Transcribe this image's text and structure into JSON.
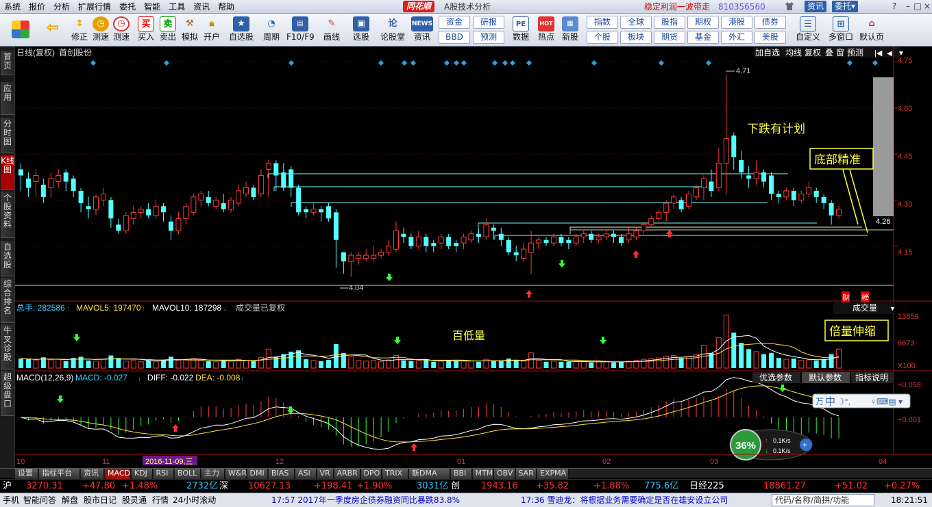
{
  "menu": {
    "items": [
      "系统",
      "报价",
      "分析",
      "扩展行情",
      "委托",
      "智能",
      "工具",
      "资讯",
      "帮助"
    ],
    "logo": "同花顺",
    "app_title": "A股技术分析",
    "slogan": "稳定利润一波带走",
    "phone": "810356560",
    "btn_info": "资讯",
    "btn_trade": "委托▾"
  },
  "toolbar": {
    "buttons": [
      {
        "label": "",
        "icon": "colorful-grid-icon"
      },
      {
        "label": "",
        "icon": "back-arrow-icon"
      },
      {
        "label": "修正",
        "icon": "up-down-icon"
      },
      {
        "label": "测速",
        "icon": "clock-icon"
      },
      {
        "label": "买入",
        "icon": "buy-icon",
        "glyph": "买"
      },
      {
        "label": "卖出",
        "icon": "sell-icon",
        "glyph": "卖"
      },
      {
        "label": "模拟",
        "icon": "hammer-icon"
      },
      {
        "label": "开户",
        "icon": "lock-icon"
      },
      {
        "label": "自选股",
        "icon": "star-icon"
      },
      {
        "label": "周期",
        "icon": "cycle-icon"
      },
      {
        "label": "F10/F9",
        "icon": "f10-icon"
      },
      {
        "label": "画线",
        "icon": "pencil-icon"
      },
      {
        "label": "选股",
        "icon": "monitor-icon"
      },
      {
        "label": "论股堂",
        "icon": "forum-icon",
        "glyph": "论"
      },
      {
        "label": "资讯",
        "icon": "news-icon",
        "glyph": "NEWS"
      },
      {
        "label": "数据",
        "icon": "pe-icon",
        "glyph": "PE"
      },
      {
        "label": "热点",
        "icon": "hot-icon",
        "glyph": "HOT"
      },
      {
        "label": "新股",
        "icon": "new-stock-icon"
      },
      {
        "label": "自定义",
        "icon": "custom-icon"
      },
      {
        "label": "多窗口",
        "icon": "multiwindow-icon"
      },
      {
        "label": "默认页",
        "icon": "home-icon"
      }
    ],
    "squares": [
      "资金",
      "BBD",
      "研报",
      "预测",
      "指数",
      "个股",
      "全球",
      "板块",
      "股指",
      "期货",
      "期权",
      "基金",
      "港股",
      "外汇",
      "债券",
      "美股"
    ]
  },
  "leftnav": [
    "首页",
    "应用",
    "分时图",
    "K线图",
    "个股资料",
    "自选股",
    "综合排名",
    "牛叉诊股",
    "超级盘口"
  ],
  "chart": {
    "title": "日线(复权)",
    "stock": "首创股份",
    "right_tools": [
      "加自选",
      "均线",
      "复权",
      "叠",
      "窗",
      "预测"
    ],
    "price_ticks": [
      "4.75",
      "4.60",
      "4.45",
      "4.30",
      "4.15"
    ],
    "current_price": "4.26",
    "high_label": "4.71",
    "low_label": "4.04",
    "annotation_fall": "下跌有计划",
    "annotation_bottom": "底部精准",
    "annotation_vol": "百低量",
    "annotation_double": "倍量伸缩",
    "btn_cai": "财",
    "btn_bang": "榜",
    "vol_header": {
      "total": "总手: 282586",
      "ma5": "MAVOL5: 197470",
      "ma10": "MAVOL10: 187298",
      "note": "成交量已复权",
      "select": "成交量"
    },
    "vol_ticks": [
      "13859",
      "6673",
      "X100"
    ],
    "macd_header": {
      "name": "MACD(12,26,9)",
      "macd": "MACD: -0.027",
      "diff": "DIFF: -0.022",
      "dea": "DEA: -0.008"
    },
    "macd_tabs": [
      "优选参数",
      "默认参数",
      "指标说明"
    ],
    "macd_ticks": [
      "+0.058",
      "+0.001"
    ],
    "x_labels": [
      "10",
      "11",
      "12",
      "01",
      "02",
      "03",
      "04"
    ],
    "cursor_date": "2016-11-09,三",
    "speed": {
      "pct": "36%",
      "up": "0.1K/s",
      "down": "0.1K/s"
    },
    "ime": "中"
  },
  "indicator_tabs": [
    "设置",
    "指标平台",
    "资讯",
    "MACD",
    "KDJ",
    "RSI",
    "BOLL",
    "主力",
    "W&R",
    "DMI",
    "BIAS",
    "ASI",
    "VR",
    "ARBR",
    "DPO",
    "TRIX",
    "新DMA",
    "BBI",
    "MTM",
    "OBV",
    "SAR",
    "EXPMA"
  ],
  "index_bar": [
    {
      "t": "沪",
      "c": "#fff"
    },
    {
      "t": "3270.31",
      "c": "#ff3030"
    },
    {
      "t": "+47.80",
      "c": "#ff3030"
    },
    {
      "t": "+1.48%",
      "c": "#ff3030"
    },
    {
      "t": "2732亿",
      "c": "#30c8ff"
    },
    {
      "t": "深",
      "c": "#fff"
    },
    {
      "t": "10627.13",
      "c": "#ff3030"
    },
    {
      "t": "+198.41",
      "c": "#ff3030"
    },
    {
      "t": "+1.90%",
      "c": "#ff3030"
    },
    {
      "t": "3031亿",
      "c": "#30c8ff"
    },
    {
      "t": "创",
      "c": "#fff"
    },
    {
      "t": "1943.16",
      "c": "#ff3030"
    },
    {
      "t": "+35.82",
      "c": "#ff3030"
    },
    {
      "t": "+1.88%",
      "c": "#ff3030"
    },
    {
      "t": "775.6亿",
      "c": "#30c8ff"
    },
    {
      "t": "日经225",
      "c": "#fff"
    },
    {
      "t": "18861.27",
      "c": "#ff3030"
    },
    {
      "t": "+51.02",
      "c": "#ff3030"
    },
    {
      "t": "+0.27%",
      "c": "#ff3030"
    }
  ],
  "status": {
    "items": [
      "手机",
      "智能问答",
      "解盘",
      "股市日记",
      "股灵通",
      "行情",
      "24小时滚动"
    ],
    "news1": "17:57 2017年一季度房企债券融资同比暴跌83.8%",
    "news2": "17:36 雪迪龙：将根据业务需要确定是否在雄安设立公司",
    "search": "代码/名称/简拼/功能",
    "time": "18:21:51"
  },
  "chart_data": {
    "type": "candlestick",
    "stock": "首创股份",
    "period": "日线(复权)",
    "ylim": [
      4.02,
      4.76
    ],
    "candles": [
      [
        4.4,
        4.38,
        4.42,
        4.33,
        "d",
        75
      ],
      [
        4.37,
        4.34,
        4.39,
        4.31,
        "d",
        70
      ],
      [
        4.36,
        4.38,
        4.4,
        4.31,
        "u",
        60
      ],
      [
        4.35,
        4.31,
        4.37,
        4.29,
        "d",
        85
      ],
      [
        4.34,
        4.37,
        4.39,
        4.31,
        "u",
        65
      ],
      [
        4.36,
        4.38,
        4.4,
        4.34,
        "u",
        70
      ],
      [
        4.39,
        4.36,
        4.4,
        4.33,
        "d",
        55
      ],
      [
        4.37,
        4.33,
        4.38,
        4.31,
        "d",
        80
      ],
      [
        4.33,
        4.29,
        4.34,
        4.26,
        "d",
        90
      ],
      [
        4.28,
        4.27,
        4.31,
        4.24,
        "d",
        60
      ],
      [
        4.27,
        4.31,
        4.32,
        4.25,
        "u",
        55
      ],
      [
        4.3,
        4.32,
        4.34,
        4.28,
        "u",
        70
      ],
      [
        4.3,
        4.24,
        4.31,
        4.21,
        "d",
        100
      ],
      [
        4.22,
        4.2,
        4.24,
        4.19,
        "d",
        80
      ],
      [
        4.2,
        4.25,
        4.26,
        4.19,
        "u",
        55
      ],
      [
        4.24,
        4.26,
        4.28,
        4.22,
        "u",
        60
      ],
      [
        4.26,
        4.27,
        4.28,
        4.24,
        "u",
        50
      ],
      [
        4.27,
        4.25,
        4.29,
        4.24,
        "d",
        60
      ],
      [
        4.25,
        4.28,
        4.3,
        4.24,
        "u",
        55
      ],
      [
        4.28,
        4.26,
        4.29,
        4.23,
        "d",
        65
      ],
      [
        4.23,
        4.2,
        4.25,
        4.17,
        "d",
        90
      ],
      [
        4.2,
        4.24,
        4.26,
        4.19,
        "u",
        60
      ],
      [
        4.24,
        4.28,
        4.29,
        4.22,
        "u",
        70
      ],
      [
        4.26,
        4.31,
        4.32,
        4.25,
        "u",
        75
      ],
      [
        4.3,
        4.32,
        4.33,
        4.28,
        "u",
        60
      ],
      [
        4.31,
        4.29,
        4.33,
        4.28,
        "d",
        55
      ],
      [
        4.28,
        4.3,
        4.31,
        4.27,
        "u",
        50
      ],
      [
        4.29,
        4.27,
        4.32,
        4.26,
        "d",
        60
      ],
      [
        4.27,
        4.3,
        4.31,
        4.26,
        "u",
        55
      ],
      [
        4.29,
        4.33,
        4.35,
        4.28,
        "u",
        70
      ],
      [
        4.32,
        4.34,
        4.36,
        4.31,
        "u",
        60
      ],
      [
        4.34,
        4.31,
        4.35,
        4.3,
        "d",
        55
      ],
      [
        4.32,
        4.38,
        4.4,
        4.31,
        "u",
        85
      ],
      [
        4.4,
        4.42,
        4.43,
        4.31,
        "u",
        150
      ],
      [
        4.42,
        4.38,
        4.43,
        4.33,
        "d",
        90
      ],
      [
        4.39,
        4.34,
        4.42,
        4.33,
        "d",
        110
      ],
      [
        4.4,
        4.34,
        4.41,
        4.31,
        "d",
        130
      ],
      [
        4.34,
        4.26,
        4.35,
        4.25,
        "d",
        140
      ],
      [
        4.27,
        4.26,
        4.28,
        4.24,
        "d",
        70
      ],
      [
        4.26,
        4.27,
        4.29,
        4.25,
        "u",
        60
      ],
      [
        4.27,
        4.26,
        4.28,
        4.23,
        "d",
        55
      ],
      [
        4.28,
        4.24,
        4.29,
        4.23,
        "d",
        65
      ],
      [
        4.26,
        4.17,
        4.27,
        4.08,
        "d",
        190
      ],
      [
        4.13,
        4.1,
        4.13,
        4.06,
        "d",
        120
      ],
      [
        4.1,
        4.12,
        4.13,
        4.05,
        "u",
        90
      ],
      [
        4.11,
        4.12,
        4.13,
        4.09,
        "u",
        60
      ],
      [
        4.11,
        4.12,
        4.14,
        4.1,
        "u",
        55
      ],
      [
        4.11,
        4.12,
        4.15,
        4.1,
        "u",
        60
      ],
      [
        4.12,
        4.13,
        4.14,
        4.11,
        "u",
        50
      ],
      [
        4.13,
        4.15,
        4.17,
        4.12,
        "u",
        65
      ],
      [
        4.14,
        4.2,
        4.23,
        4.13,
        "u",
        100
      ],
      [
        4.19,
        4.18,
        4.21,
        4.16,
        "d",
        60
      ],
      [
        4.18,
        4.15,
        4.19,
        4.14,
        "d",
        55
      ],
      [
        4.15,
        4.18,
        4.2,
        4.14,
        "u",
        60
      ],
      [
        4.18,
        4.15,
        4.19,
        4.13,
        "d",
        70
      ],
      [
        4.15,
        4.16,
        4.17,
        4.13,
        "d",
        50
      ],
      [
        4.16,
        4.18,
        4.19,
        4.14,
        "u",
        55
      ],
      [
        4.18,
        4.15,
        4.19,
        4.14,
        "d",
        60
      ],
      [
        4.15,
        4.16,
        4.17,
        4.13,
        "d",
        55
      ],
      [
        4.16,
        4.18,
        4.19,
        4.14,
        "u",
        60
      ],
      [
        4.17,
        4.19,
        4.2,
        4.16,
        "u",
        55
      ],
      [
        4.19,
        4.18,
        4.21,
        4.16,
        "d",
        50
      ],
      [
        4.18,
        4.22,
        4.24,
        4.17,
        "u",
        70
      ],
      [
        4.21,
        4.2,
        4.22,
        4.17,
        "d",
        55
      ],
      [
        4.19,
        4.17,
        4.21,
        4.15,
        "d",
        60
      ],
      [
        4.17,
        4.13,
        4.18,
        4.12,
        "d",
        75
      ],
      [
        4.13,
        4.12,
        4.15,
        4.1,
        "d",
        60
      ],
      [
        4.11,
        4.14,
        4.16,
        4.1,
        "u",
        55
      ],
      [
        4.13,
        4.16,
        4.2,
        4.06,
        "u",
        120
      ],
      [
        4.16,
        4.17,
        4.18,
        4.14,
        "u",
        60
      ],
      [
        4.17,
        4.16,
        4.18,
        4.15,
        "d",
        50
      ],
      [
        4.16,
        4.18,
        4.19,
        4.15,
        "u",
        55
      ],
      [
        4.18,
        4.16,
        4.19,
        4.15,
        "d",
        50
      ],
      [
        4.16,
        4.17,
        4.18,
        4.14,
        "d",
        50
      ],
      [
        4.16,
        4.18,
        4.19,
        4.15,
        "u",
        55
      ],
      [
        4.18,
        4.19,
        4.2,
        4.16,
        "u",
        50
      ],
      [
        4.19,
        4.17,
        4.2,
        4.16,
        "d",
        45
      ],
      [
        4.17,
        4.18,
        4.19,
        4.16,
        "u",
        50
      ],
      [
        4.18,
        4.19,
        4.2,
        4.17,
        "u",
        55
      ],
      [
        4.19,
        4.18,
        4.2,
        4.16,
        "d",
        45
      ],
      [
        4.18,
        4.16,
        4.19,
        4.15,
        "d",
        50
      ],
      [
        4.17,
        4.19,
        4.21,
        4.16,
        "u",
        55
      ],
      [
        4.18,
        4.2,
        4.21,
        4.17,
        "u",
        60
      ],
      [
        4.2,
        4.22,
        4.23,
        4.19,
        "u",
        70
      ],
      [
        4.22,
        4.24,
        4.25,
        4.21,
        "u",
        75
      ],
      [
        4.24,
        4.26,
        4.27,
        4.23,
        "u",
        80
      ],
      [
        4.26,
        4.29,
        4.3,
        4.23,
        "u",
        95
      ],
      [
        4.29,
        4.31,
        4.32,
        4.27,
        "u",
        100
      ],
      [
        4.3,
        4.27,
        4.31,
        4.26,
        "d",
        80
      ],
      [
        4.28,
        4.32,
        4.33,
        4.27,
        "u",
        90
      ],
      [
        4.31,
        4.34,
        4.35,
        4.3,
        "u",
        110
      ],
      [
        4.34,
        4.37,
        4.38,
        4.3,
        "u",
        180
      ],
      [
        4.36,
        4.33,
        4.4,
        4.31,
        "d",
        120
      ],
      [
        4.34,
        4.42,
        4.47,
        4.33,
        "u",
        240
      ],
      [
        4.42,
        4.5,
        4.71,
        4.32,
        "u",
        420
      ],
      [
        4.51,
        4.44,
        4.52,
        4.4,
        "d",
        280
      ],
      [
        4.43,
        4.39,
        4.46,
        4.37,
        "d",
        200
      ],
      [
        4.38,
        4.37,
        4.41,
        4.34,
        "d",
        150
      ],
      [
        4.37,
        4.39,
        4.43,
        4.35,
        "u",
        130
      ],
      [
        4.39,
        4.36,
        4.4,
        4.34,
        "d",
        110
      ],
      [
        4.38,
        4.32,
        4.39,
        4.3,
        "d",
        120
      ],
      [
        4.32,
        4.31,
        4.33,
        4.29,
        "d",
        80
      ],
      [
        4.31,
        4.33,
        4.34,
        4.3,
        "u",
        70
      ],
      [
        4.33,
        4.3,
        4.34,
        4.28,
        "d",
        75
      ],
      [
        4.3,
        4.32,
        4.33,
        4.29,
        "u",
        60
      ],
      [
        4.32,
        4.34,
        4.36,
        4.31,
        "u",
        65
      ],
      [
        4.33,
        4.31,
        4.34,
        4.29,
        "d",
        60
      ],
      [
        4.31,
        4.29,
        4.32,
        4.27,
        "d",
        70
      ],
      [
        4.29,
        4.25,
        4.3,
        4.22,
        "d",
        110
      ],
      [
        4.25,
        4.27,
        4.28,
        4.24,
        "u",
        150
      ]
    ]
  }
}
